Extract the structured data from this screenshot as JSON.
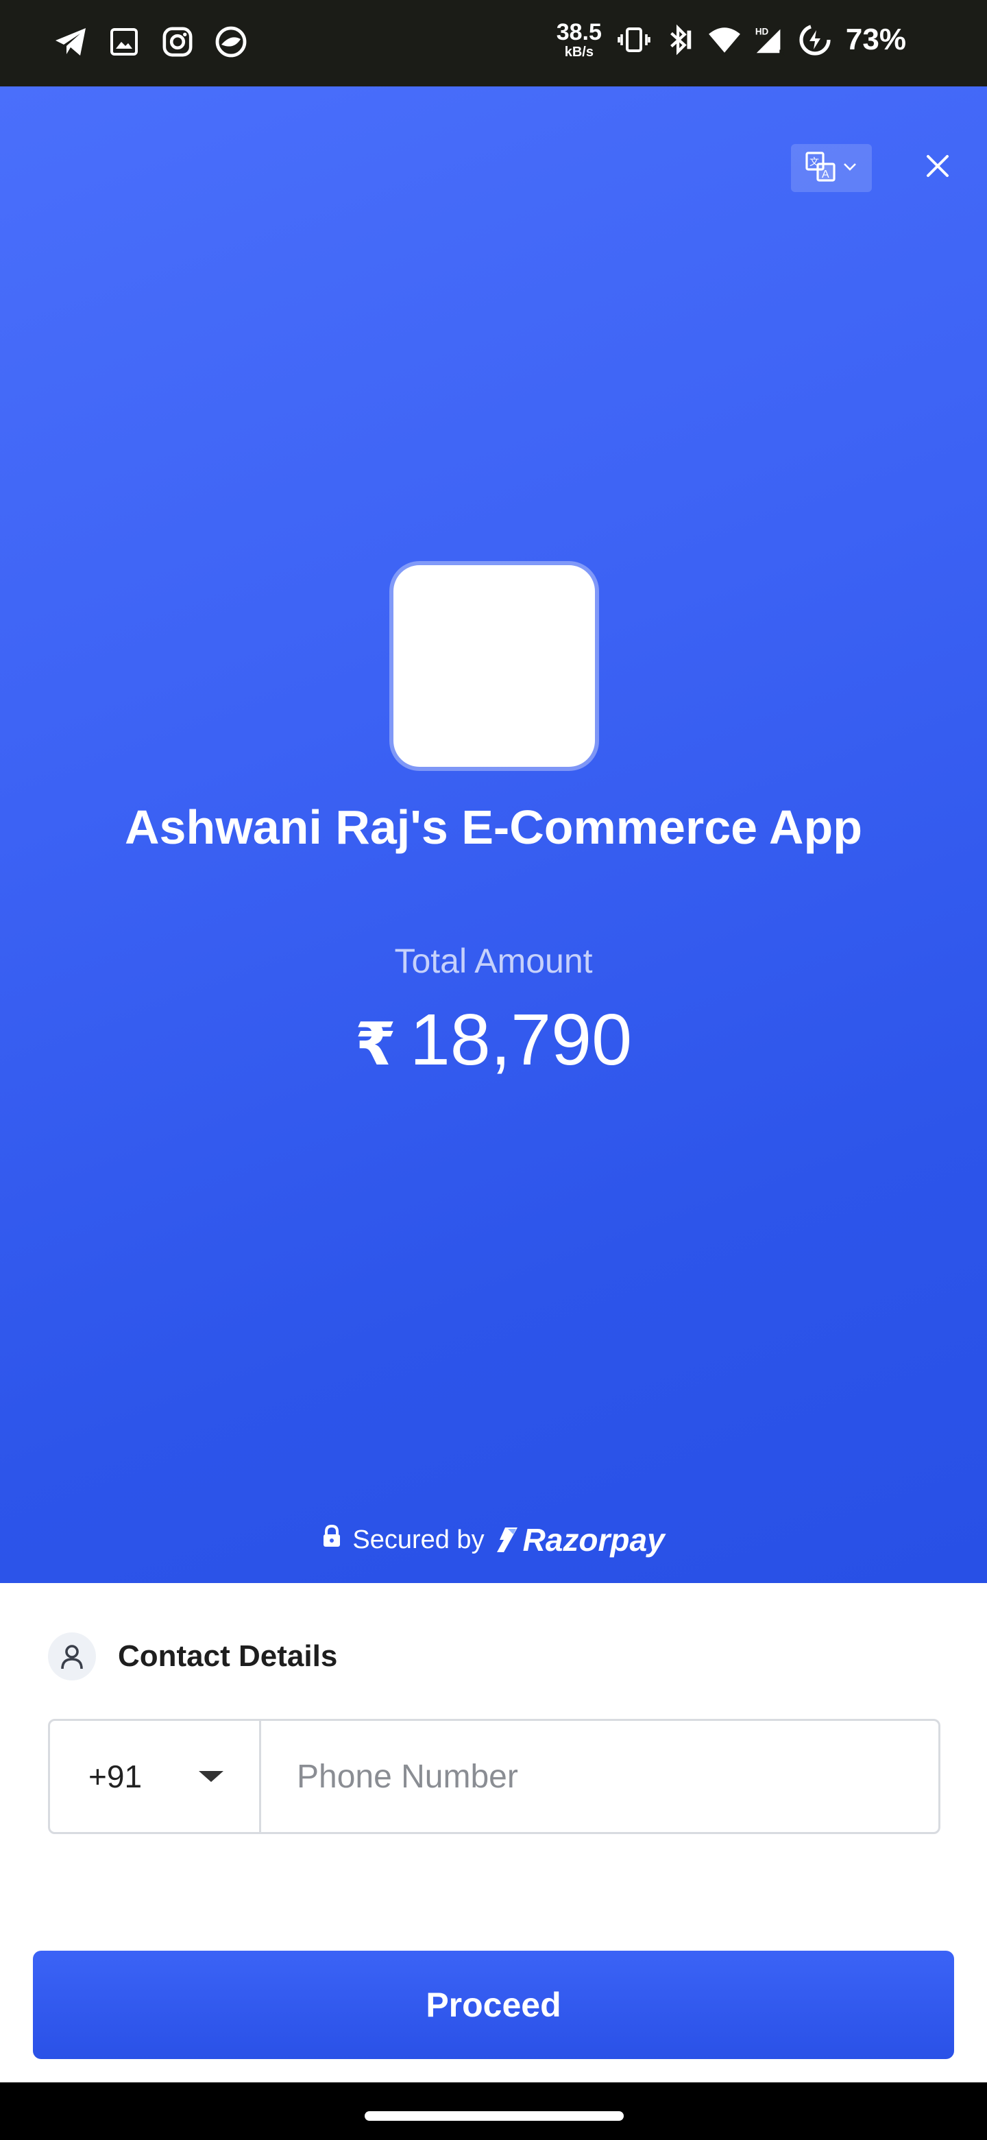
{
  "status_bar": {
    "net_speed_value": "38.5",
    "net_speed_unit": "kB/s",
    "battery_percent": "73%",
    "icons": [
      "telegram-icon",
      "gallery-icon",
      "instagram-icon",
      "app-icon",
      "vibrate-icon",
      "bluetooth-icon",
      "wifi-icon",
      "signal-hd-icon",
      "battery-charging-icon"
    ]
  },
  "header": {
    "language_icon": "translate-icon",
    "close_icon": "close-icon"
  },
  "merchant": {
    "name": "Ashwani Raj's E-Commerce App"
  },
  "payment": {
    "total_label": "Total Amount",
    "currency_symbol": "₹",
    "amount": "18,790"
  },
  "footer_brand": {
    "secured_by": "Secured by",
    "brand": "Razorpay"
  },
  "contact": {
    "title": "Contact Details",
    "country_code": "+91",
    "phone_placeholder": "Phone Number",
    "phone_value": ""
  },
  "actions": {
    "proceed_label": "Proceed"
  },
  "colors": {
    "primary_blue": "#3c62f4",
    "button_blue": "#2d55ea",
    "status_bar_bg": "#1b1c17"
  }
}
